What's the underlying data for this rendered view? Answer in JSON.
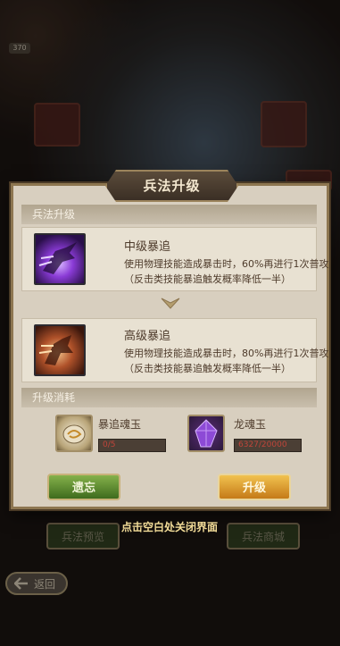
{
  "background": {
    "level_badge": "370",
    "preview_button": "兵法预览",
    "shop_button": "兵法商城",
    "back_button": "返回"
  },
  "dialog": {
    "title": "兵法升级",
    "section_upgrade": "兵法升级",
    "current_skill": {
      "name": "中级暴追",
      "description": "使用物理技能造成暴击时，60%再进行1次普攻（反击类技能暴追触发概率降低一半）",
      "icon": "purple-warrior-dash-icon"
    },
    "next_skill": {
      "name": "高级暴追",
      "description": "使用物理技能造成暴击时，80%再进行1次普攻（反击类技能暴追触发概率降低一半）",
      "icon": "orange-warrior-dash-icon"
    },
    "section_cost": "升级消耗",
    "costs": [
      {
        "name": "暴追魂玉",
        "progress": "0/5",
        "icon": "jade-scroll-icon"
      },
      {
        "name": "龙魂玉",
        "progress": "6327/20000",
        "icon": "purple-gem-icon"
      }
    ],
    "forget_button": "遗忘",
    "upgrade_button": "升级",
    "close_hint": "点击空白处关闭界面"
  }
}
